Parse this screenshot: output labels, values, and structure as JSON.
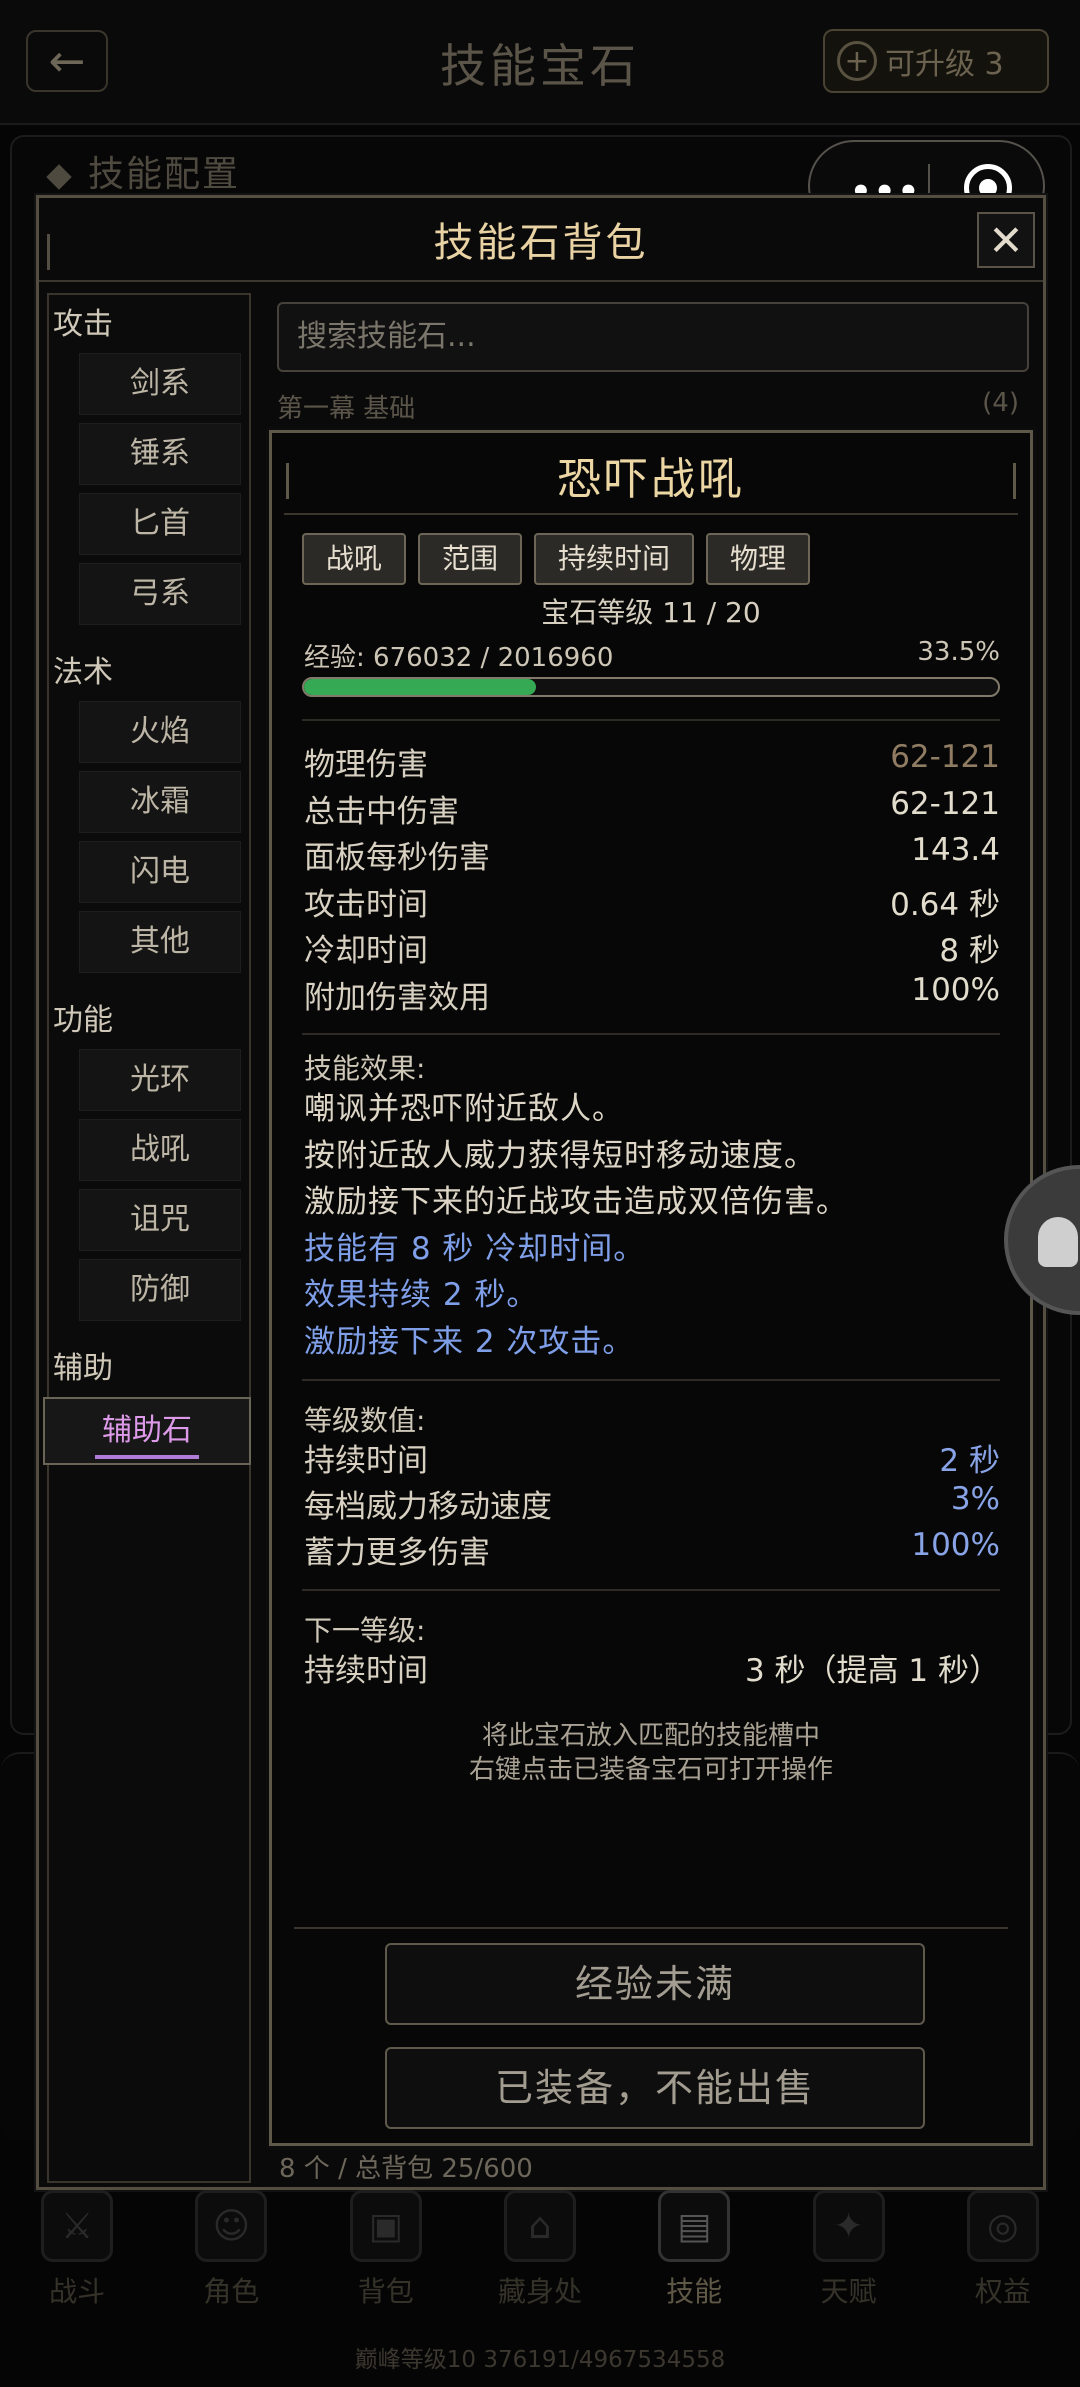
{
  "header": {
    "back_icon": "←",
    "title": "技能宝石",
    "upgrade_label": "可升级 3",
    "upgrade_icon": "+"
  },
  "section": {
    "title": "技能配置"
  },
  "capsule": {
    "dots": "•••"
  },
  "bag": {
    "title": "技能石背包",
    "close_icon": "✕",
    "search_placeholder": "搜索技能石...",
    "list_header": {
      "name": "第一幕 基础",
      "count": "(4)"
    },
    "footer": "8 个 / 总背包 25/600",
    "categories": [
      {
        "label": "攻击",
        "items": [
          "剑系",
          "锤系",
          "匕首",
          "弓系"
        ]
      },
      {
        "label": "法术",
        "items": [
          "火焰",
          "冰霜",
          "闪电",
          "其他"
        ]
      },
      {
        "label": "功能",
        "items": [
          "光环",
          "战吼",
          "诅咒",
          "防御"
        ]
      },
      {
        "label": "辅助",
        "items": [
          "辅助石"
        ]
      }
    ],
    "active_category": "辅助石"
  },
  "gem": {
    "name": "恐吓战吼",
    "tags": [
      "战吼",
      "范围",
      "持续时间",
      "物理"
    ],
    "level_text": "宝石等级 11 / 20",
    "exp_label": "经验: 676032 / 2016960",
    "exp_percent_text": "33.5%",
    "exp_progress": 0.335,
    "stats": [
      {
        "label": "物理伤害",
        "value": "62-121",
        "style": "muted"
      },
      {
        "label": "总击中伤害",
        "value": "62-121",
        "style": ""
      },
      {
        "label": "面板每秒伤害",
        "value": "143.4",
        "style": ""
      },
      {
        "label": "攻击时间",
        "value": "0.64 秒",
        "style": ""
      },
      {
        "label": "冷却时间",
        "value": "8 秒",
        "style": ""
      },
      {
        "label": "附加伤害效用",
        "value": "100%",
        "style": ""
      }
    ],
    "effect_label": "技能效果:",
    "effects": [
      {
        "text": "嘲讽并恐吓附近敌人。",
        "style": ""
      },
      {
        "text": "按附近敌人威力获得短时移动速度。",
        "style": ""
      },
      {
        "text": "激励接下来的近战攻击造成双倍伤害。",
        "style": ""
      },
      {
        "text": "技能有 8 秒 冷却时间。",
        "style": "blue"
      },
      {
        "text": "效果持续 2 秒。",
        "style": "blue"
      },
      {
        "text": "激励接下来 2 次攻击。",
        "style": "blue"
      }
    ],
    "level_values_label": "等级数值:",
    "level_values": [
      {
        "label": "持续时间",
        "value": "2 秒"
      },
      {
        "label": "每档威力移动速度",
        "value": "3%"
      },
      {
        "label": "蓄力更多伤害",
        "value": "100%"
      }
    ],
    "next_level_label": "下一等级:",
    "next_level": {
      "label": "持续时间",
      "value": "3 秒（提高 1 秒）"
    },
    "hint_line1": "将此宝石放入匹配的技能槽中",
    "hint_line2": "右键点击已装备宝石可打开操作",
    "btn_exp": "经验未满",
    "btn_sell": "已装备，不能出售"
  },
  "nav": [
    {
      "label": "战斗",
      "icon": "crossed-swords-icon",
      "glyph": "⚔"
    },
    {
      "label": "角色",
      "icon": "character-icon",
      "glyph": "☺"
    },
    {
      "label": "背包",
      "icon": "backpack-icon",
      "glyph": "▣"
    },
    {
      "label": "藏身处",
      "icon": "hideout-icon",
      "glyph": "⌂"
    },
    {
      "label": "技能",
      "icon": "skill-book-icon",
      "glyph": "▤"
    },
    {
      "label": "天赋",
      "icon": "talent-icon",
      "glyph": "✦"
    },
    {
      "label": "权益",
      "icon": "benefit-icon",
      "glyph": "◎"
    }
  ],
  "nav_active": "技能",
  "footer": "巅峰等级10  376191/4967534558"
}
